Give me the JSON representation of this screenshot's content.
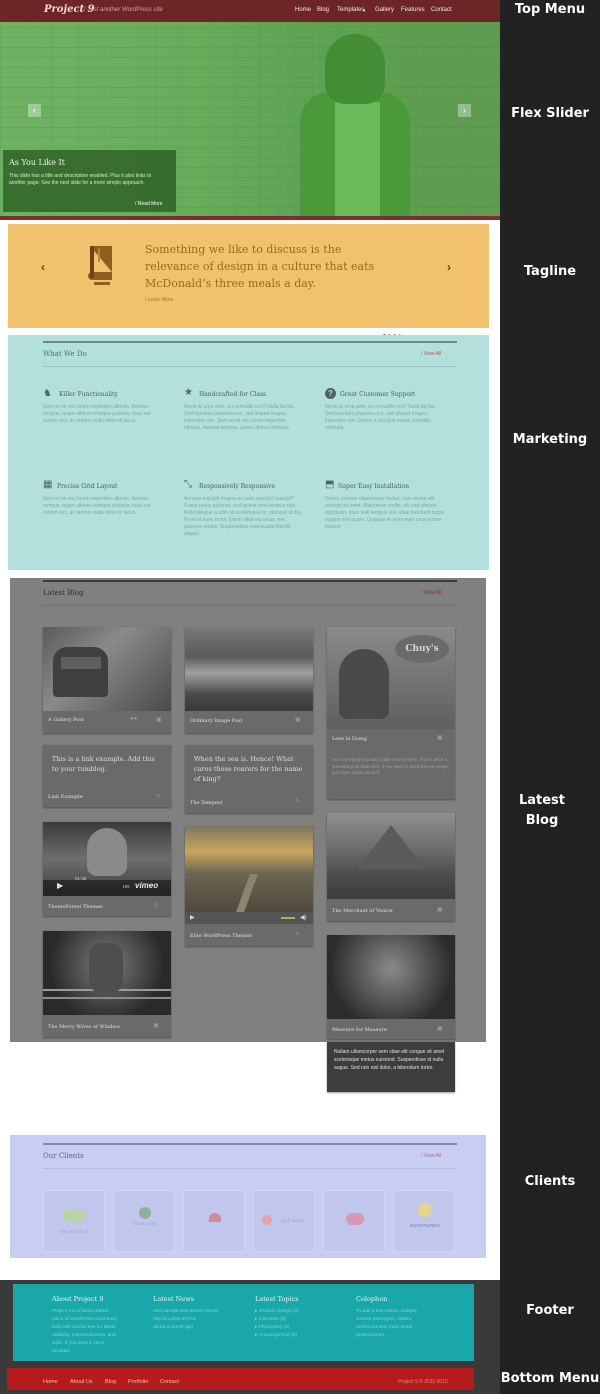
{
  "annotations": {
    "top_menu": "Top Menu",
    "flex_slider": "Flex Slider",
    "tagline": "Tagline",
    "marketing": "Marketing",
    "latest_blog_1": "Latest",
    "latest_blog_2": "Blog",
    "clients": "Clients",
    "footer": "Footer",
    "bottom_menu": "Bottom Menu"
  },
  "header": {
    "logo": "Project 9",
    "tagline": "/ Just another WordPress site",
    "nav": [
      "Home",
      "Blog",
      "Templates",
      "Gallery",
      "Features",
      "Contact"
    ]
  },
  "slider": {
    "prev": "‹",
    "next": "›",
    "caption_title": "As You Like It",
    "caption_text": "This slide has a title and description enabled. Plus it also links to another page. See the next slide for a more simple approach.",
    "caption_more": "/ Read More"
  },
  "tagline": {
    "quote": "Something we like to discuss is the relevance of design in a culture that eats McDonald’s three meals a day.",
    "more": "/ Learn More",
    "prev": "‹",
    "next": "›",
    "slide_count": 4,
    "active_slide": 1
  },
  "marketing": {
    "title": "What We Do",
    "view_all": "/ View All",
    "features": [
      {
        "icon": "dog-icon",
        "glyph": "♞",
        "title": "Killer Functionality",
        "text": "Sed vel mi nec lorem imperdiet ultrices. Aenean tempus, quam ultrices tristique pulvinar, risus est rutrum orci, ac tempor nulla tellus id lacus."
      },
      {
        "icon": "star-icon",
        "glyph": "★",
        "title": "Handcrafted for Class",
        "text": "Morbi at urna ante, eu convallis orci? Nulla facilisi. Sed faucibus pharetra orci, sed aliquet magna imperdiet non. Sed vel mi nec lorem imperdiet ultrices. Aenean tempus, quam ultrices tristique."
      },
      {
        "icon": "question-icon",
        "glyph": "?",
        "title": "Great Customer Support",
        "text": "Morbi at urna ante, eu convallis orci? Nulla facilisi. Sed faucibus pharetra orci, sed aliquet magna imperdiet non. Donec a dui quis metus convallis vehicula."
      },
      {
        "icon": "grid-icon",
        "glyph": "▦",
        "title": "Precise Grid Layout",
        "text": "Sed vel mi nec lorem imperdiet ultrices. Aenean tempus, quam ultrices tristique pulvinar, risus est rutrum orci, ac tempor nulla tellus id lacus."
      },
      {
        "icon": "resize-icon",
        "glyph": "⤡",
        "title": "Responsively Responsive",
        "text": "Aenean suscipit magna ac nunc suscipit suscipit? Fusce purus pulvinar, sed lacinia eros tempus non. Pellentesque a nibh sit scelerisque in, placerat ut dui. Proin et nunc tortor. Etiam vitae est lacus, nec posuere metus. Suspendisse malesuada blandit aliquet."
      },
      {
        "icon": "install-icon",
        "glyph": "⬒",
        "title": "Super Easy Installation",
        "text": "Donec pretium ullamcorper lectus, non ornare elit suscipit sit amet. Maecenas mollis, elit sed ultrices dignissim, risus velit tempus nisi, vitae hendrerit turpis magna non quam. Quisque et enim eget urna ornare tempor."
      }
    ]
  },
  "blog": {
    "title": "Latest Blog",
    "view_all": "/ View All",
    "posts": [
      {
        "title": "A Gallery Post",
        "icon": "gallery-icon",
        "glyph": "●●"
      },
      {
        "title": "Ordinary Image Post",
        "icon": "image-icon",
        "glyph": "▣"
      },
      {
        "title": "Love Is Dumg",
        "icon": "image-icon",
        "glyph": "▣",
        "excerpt": "You can easily just add a little excerpt here. This is what a standard post looks like. If you want to put these on image, you have option as well."
      },
      {
        "title": "Link Example",
        "icon": "link-icon",
        "glyph": "✎",
        "quote": "This is a link example. Add this to your tumblog."
      },
      {
        "title": "The Tempest",
        "icon": "quote-icon",
        "glyph": "✎",
        "quote": "When the sea is. Hence! What cares these roarers for the name of king?"
      },
      {
        "title": "ThemeForest Themes",
        "icon": "play-icon",
        "glyph": "▶",
        "video_brand": "vimeo",
        "video_time": "01:38"
      },
      {
        "title": "Elite WordPress Themes",
        "icon": "audio-icon",
        "glyph": "✎"
      },
      {
        "title": "The Merchant of Venice",
        "icon": "image-icon",
        "glyph": "▣"
      },
      {
        "title": "The Merry Wives of Windsor",
        "icon": "image-icon",
        "glyph": "▣"
      },
      {
        "title": "Measure for Measure",
        "icon": "image-icon",
        "glyph": "▣",
        "hover_text": "Nullam ullamcorper sem vitae elit congue sit amet scelerisque metus euismod. Suspendisse id nulla augue. Sed non nisl dolor, a bibendum tortor."
      }
    ],
    "vimeo_watermark": "HD",
    "chuys_sign": "Chuy's"
  },
  "clients": {
    "title": "Our Clients",
    "view_all": "/ View All",
    "logos": [
      "GRAFICYROU",
      "woodcorner",
      "",
      "graff factory",
      "",
      "eucomunico"
    ]
  },
  "footer": {
    "cols": [
      {
        "title": "About Project 9",
        "lines": [
          "Project 9 is a hand-crafted",
          "piece of WordPress machinery,",
          "built with careful eye for detail,",
          "usability, responsiveness, and",
          "style. If you want it, don't",
          "hesitate!"
        ]
      },
      {
        "title": "Latest News",
        "lines": [
          "new sample site! Eleven Mode",
          "http://t.co/bpHr47C5",
          "about a month ago"
        ]
      },
      {
        "title": "Latest Topics",
        "lines": [
          "Graphic Design (2)",
          "Literature (5)",
          "Philosophy (4)",
          "Uncategorized (6)"
        ]
      },
      {
        "title": "Colophon",
        "lines": [
          "To add a few extras, multiple",
          "custom post types, sliders,",
          "perfect control, easy setup,",
          "great support..."
        ]
      }
    ]
  },
  "bottom_menu": {
    "links": [
      "Home",
      "About Us",
      "Blog",
      "Portfolio",
      "Contact"
    ],
    "copyright": "Project 9 © 2011-2012"
  },
  "colors": {
    "top_menu": "#6d2525",
    "slider_tint": "#46aa3c",
    "tagline": "#f1c16e",
    "marketing": "#b3e0dd",
    "blog": "#808080",
    "clients": "#c8cdf4",
    "footer": "#1aa7a9",
    "bottom_menu": "#b51b1b"
  }
}
